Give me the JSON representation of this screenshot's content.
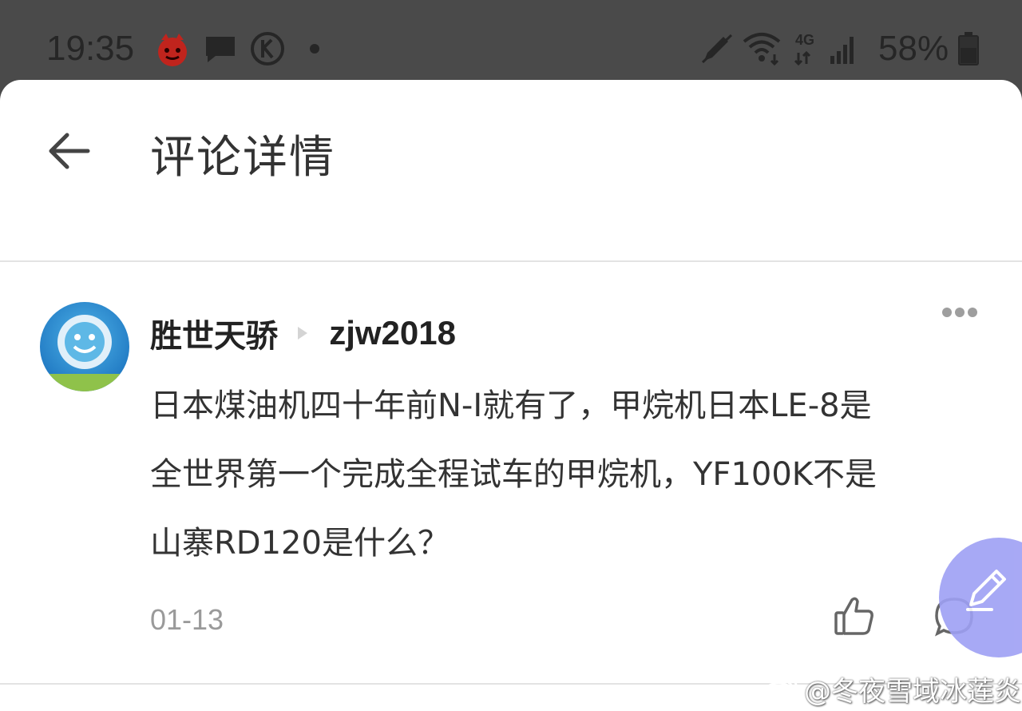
{
  "status_bar": {
    "time": "19:35",
    "icons": [
      "game-icon",
      "message-icon",
      "k-circle-icon",
      "pen-icon",
      "wifi-icon",
      "4g-signal-icon",
      "battery-icon"
    ],
    "network_label": "4G",
    "battery": "58%"
  },
  "header": {
    "back_icon": "arrow-left-icon",
    "title": "评论详情"
  },
  "comment": {
    "author": "胜世天骄",
    "reply_to": "zjw2018",
    "text_lines": [
      "日本煤油机四十年前N-I就有了，甲烷机日本LE-8是",
      "全世界第一个完成全程试车的甲烷机，YF100K不是",
      "山寨RD120是什么？"
    ],
    "date": "01-13",
    "more_icon": "more-horizontal-icon",
    "like_icon": "thumbs-up-icon",
    "reply_icon": "comment-bubble-icon"
  },
  "fab": {
    "icon": "pen-icon"
  },
  "watermark": {
    "text": "@冬夜雪域冰莲炎",
    "icon": "weibo-icon"
  },
  "colors": {
    "status_bar_bg": "#4a4a4a",
    "sheet_bg": "#ffffff",
    "fab_bg": "#9ea0f4",
    "text_primary": "#222222",
    "text_secondary": "#9a9a9a"
  }
}
